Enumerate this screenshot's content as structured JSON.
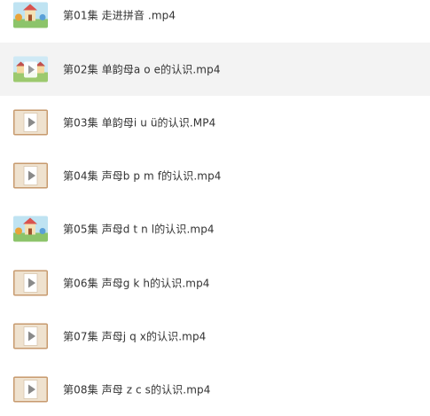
{
  "files": [
    {
      "name": "第01集 走进拼音 .mp4",
      "thumb": "cartoon-house-thumbnail"
    },
    {
      "name": "第02集 单韵母a o e的认识.mp4",
      "thumb": "cartoon-landscape-thumbnail"
    },
    {
      "name": "第03集 单韵母i u ü的认识.MP4",
      "thumb": "video-play-thumbnail"
    },
    {
      "name": "第04集 声母b p m f的认识.mp4",
      "thumb": "video-play-thumbnail"
    },
    {
      "name": "第05集 声母d t n l的认识.mp4",
      "thumb": "cartoon-house-thumbnail"
    },
    {
      "name": "第06集 声母g k h的认识.mp4",
      "thumb": "video-play-thumbnail"
    },
    {
      "name": "第07集 声母j q x的认识.mp4",
      "thumb": "video-play-thumbnail"
    },
    {
      "name": "第08集 声母 z c s的认识.mp4",
      "thumb": "video-play-thumbnail"
    }
  ]
}
